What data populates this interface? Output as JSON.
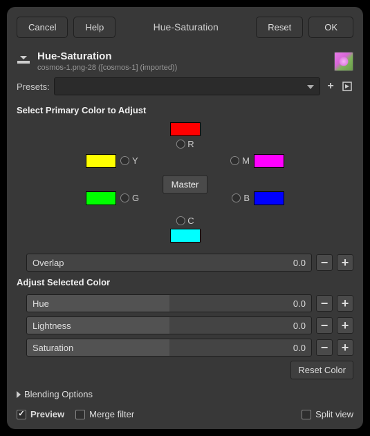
{
  "titlebar": {
    "cancel": "Cancel",
    "help": "Help",
    "title": "Hue-Saturation",
    "reset": "Reset",
    "ok": "OK"
  },
  "header": {
    "title": "Hue-Saturation",
    "subtitle": "cosmos-1.png-28 ([cosmos-1] (imported))"
  },
  "presets": {
    "label": "Presets:"
  },
  "select_primary": {
    "title": "Select Primary Color to Adjust",
    "master": "Master",
    "colors": {
      "R": "R",
      "M": "M",
      "B": "B",
      "C": "C",
      "G": "G",
      "Y": "Y"
    }
  },
  "overlap": {
    "label": "Overlap",
    "value": "0.0"
  },
  "adjust_title": "Adjust Selected Color",
  "hue": {
    "label": "Hue",
    "value": "0.0"
  },
  "lightness": {
    "label": "Lightness",
    "value": "0.0"
  },
  "saturation": {
    "label": "Saturation",
    "value": "0.0"
  },
  "reset_color": "Reset Color",
  "blending": "Blending Options",
  "preview": "Preview",
  "merge_filter": "Merge filter",
  "split_view": "Split view"
}
